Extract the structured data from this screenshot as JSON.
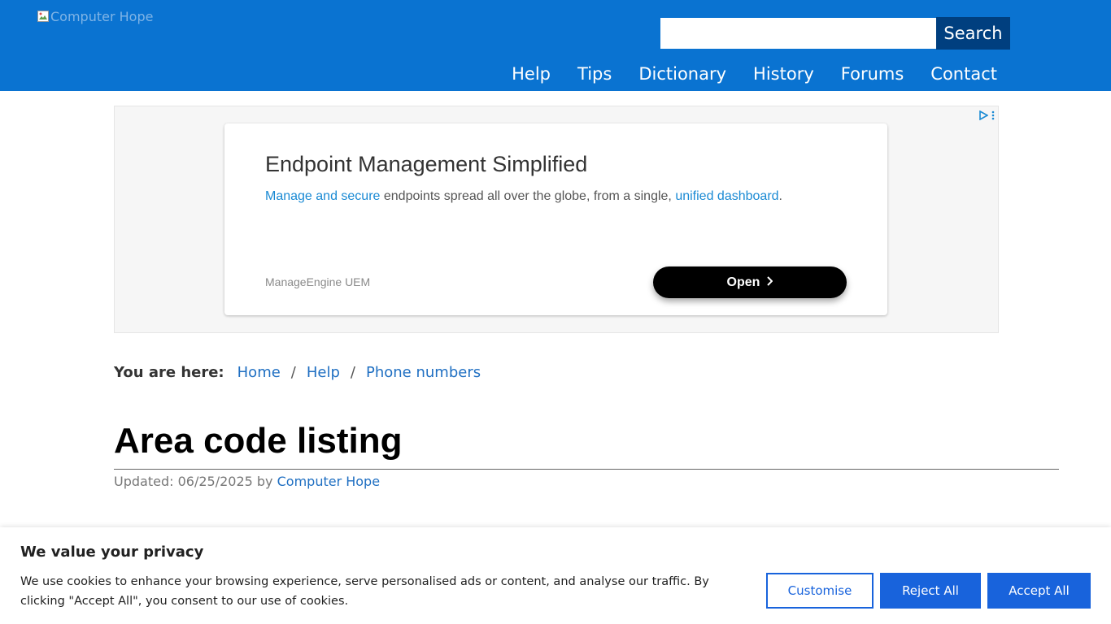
{
  "header": {
    "logo_alt": "Computer Hope",
    "search": {
      "placeholder": "",
      "value": "",
      "button_label": "Search"
    },
    "nav": [
      "Help",
      "Tips",
      "Dictionary",
      "History",
      "Forums",
      "Contact"
    ]
  },
  "ad": {
    "title": "Endpoint Management Simplified",
    "text_link1": "Manage and secure",
    "text_mid": " endpoints spread all over the globe, from a single, ",
    "text_link2": "unified dashboard",
    "text_end": ".",
    "brand": "ManageEngine UEM",
    "open_label": "Open",
    "icons": [
      "adchoices-play-icon",
      "more-vertical-icon",
      "chevron-right-icon"
    ]
  },
  "breadcrumb": {
    "label": "You are here:",
    "items": [
      "Home",
      "Help",
      "Phone numbers"
    ],
    "separator": "/"
  },
  "page": {
    "title": "Area code listing",
    "updated_prefix": "Updated: 06/25/2025 by",
    "author": "Computer Hope"
  },
  "cookie": {
    "title": "We value your privacy",
    "text": "We use cookies to enhance your browsing experience, serve personalised ads or content, and analyse our traffic. By clicking \"Accept All\", you consent to our use of cookies.",
    "customise": "Customise",
    "reject": "Reject All",
    "accept": "Accept All"
  },
  "colors": {
    "header_bg": "#0a73d1",
    "search_button_bg": "#003f7f",
    "link": "#1f6fc2",
    "cookie_button": "#1863dc"
  }
}
